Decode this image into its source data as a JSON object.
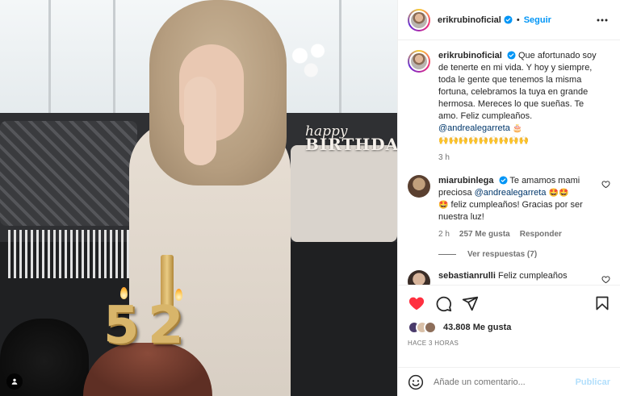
{
  "post": {
    "username": "erikrubinoficial",
    "follow_label": "Seguir",
    "dot": "•",
    "photo": {
      "sign_line1": "happy",
      "sign_line2": "BIRTHDAY",
      "candle_digit1": "5",
      "candle_digit2": "2"
    }
  },
  "caption": {
    "username": "erikrubinoficial",
    "text": "Que afortunado soy de tenerte en mi vida. Y hoy y siempre, toda le gente que tenemos la misma fortuna, celebramos la tuya en grande hermosa. Mereces lo que sueñas. Te amo. Feliz cumpleaños.",
    "mention": "@andrealegarreta",
    "emoji_cake": "🎂",
    "emoji_row": "🙌🙌🙌🙌🙌🙌🙌🙌🙌",
    "time": "3 h"
  },
  "comments": [
    {
      "username": "miarubinlega",
      "text_before": "Te amamos mami preciosa",
      "mention": "@andrealegarreta",
      "emoji_a": "🤩🤩",
      "text_after": "feliz cumpleaños! Gracias por ser nuestra luz!",
      "emoji_b": "🤩",
      "time": "2 h",
      "likes": "257 Me gusta",
      "reply": "Responder",
      "view_replies": "Ver respuestas (7)"
    },
    {
      "username": "sebastianrulli",
      "text": "Feliz cumpleaños"
    }
  ],
  "actions": {
    "likes_count": "43.808 Me gusta",
    "time_ago": "HACE 3 HORAS"
  },
  "composer": {
    "placeholder": "Añade un comentario...",
    "publish_label": "Publicar"
  },
  "colors": {
    "accent": "#0095f6",
    "like_red": "#ff3040",
    "verified": "#0095f6"
  }
}
